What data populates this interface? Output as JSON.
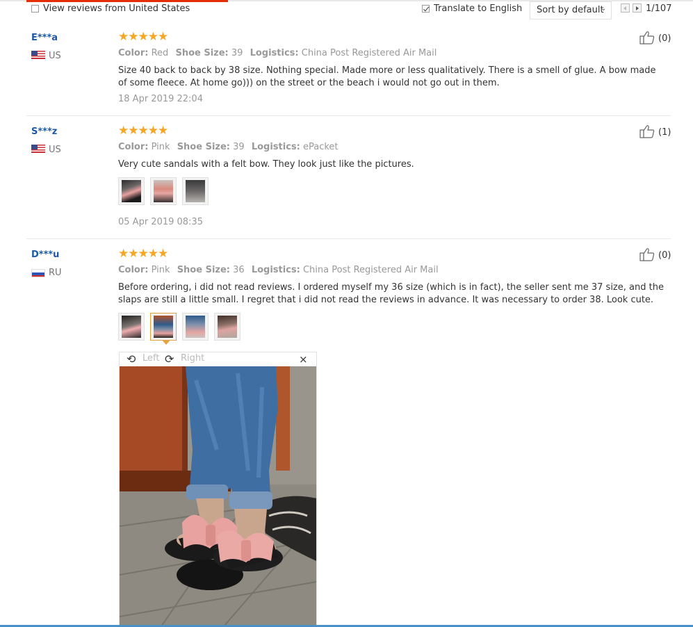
{
  "filters": {
    "country_filter_label": "View reviews from United States",
    "country_filter_checked": false,
    "translate_label": "Translate to English",
    "translate_checked": true,
    "sort_label": "Sort by default",
    "pager": "1/107"
  },
  "reviews": [
    {
      "user": "E***a",
      "country": "US",
      "stars": "★★★★★",
      "attrs": [
        {
          "label": "Color:",
          "value": "Red"
        },
        {
          "label": "Shoe Size:",
          "value": "39"
        },
        {
          "label": "Logistics:",
          "value": "China Post Registered Air Mail"
        }
      ],
      "text": "Size 40 back to back by 38 size. Nothing special. Made more or less qualitatively. There is a smell of glue. A bow made of some fleece. At home go))) on the street or the beach i would not go out in them.",
      "date": "18 Apr 2019 22:04",
      "helpful": "(0)"
    },
    {
      "user": "S***z",
      "country": "US",
      "stars": "★★★★★",
      "attrs": [
        {
          "label": "Color:",
          "value": "Pink"
        },
        {
          "label": "Shoe Size:",
          "value": "39"
        },
        {
          "label": "Logistics:",
          "value": "ePacket"
        }
      ],
      "text": "Very cute sandals with a felt bow. They look just like the pictures.",
      "date": "05 Apr 2019 08:35",
      "helpful": "(1)"
    },
    {
      "user": "D***u",
      "country": "RU",
      "stars": "★★★★★",
      "attrs": [
        {
          "label": "Color:",
          "value": "Pink"
        },
        {
          "label": "Shoe Size:",
          "value": "36"
        },
        {
          "label": "Logistics:",
          "value": "China Post Registered Air Mail"
        }
      ],
      "text": "Before ordering, i did not read reviews. I ordered myself my 36 size (which is in fact), the seller sent me 37 size, and the slaps are still a little small. I regret that i did not read the reviews in advance. It was necessary to order 38. Look cute.",
      "helpful": "(0)"
    }
  ],
  "viewer": {
    "rotate_left_label": "Left",
    "rotate_right_label": "Right",
    "close_glyph": "×"
  },
  "icons": {
    "thumb_up": "thumb-up-icon",
    "rotate_left": "rotate-left-icon",
    "rotate_right": "rotate-right-icon",
    "close": "close-icon"
  },
  "colors": {
    "accent": "#e62e04",
    "star": "#f5a623",
    "username": "#1d5aa6",
    "muted": "#999999",
    "active_thumb": "#e6a23c"
  }
}
